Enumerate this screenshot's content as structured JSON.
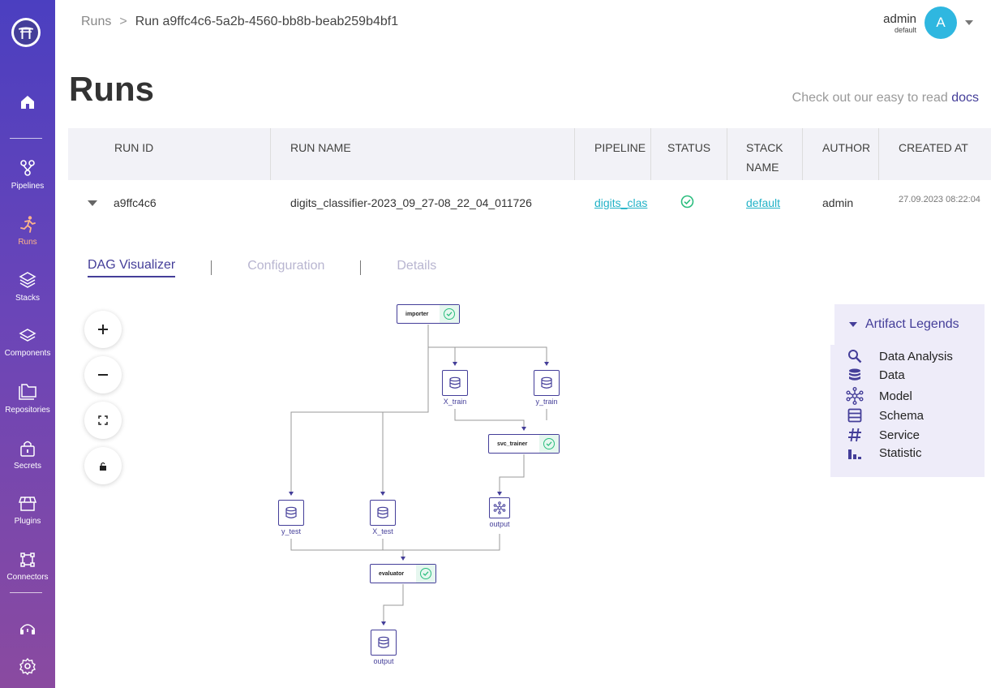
{
  "sidebar": {
    "items": [
      {
        "label": ""
      },
      {
        "label": "Pipelines"
      },
      {
        "label": "Runs"
      },
      {
        "label": "Stacks"
      },
      {
        "label": "Components"
      },
      {
        "label": "Repositories"
      },
      {
        "label": "Secrets"
      },
      {
        "label": "Plugins"
      },
      {
        "label": "Connectors"
      }
    ]
  },
  "breadcrumb": {
    "root": "Runs",
    "separator": ">",
    "current": "Run a9ffc4c6-5a2b-4560-bb8b-beab259b4bf1"
  },
  "user": {
    "name": "admin",
    "workspace": "default",
    "avatar_letter": "A"
  },
  "page": {
    "title": "Runs",
    "docs_prefix": "Check out our easy to read",
    "docs_link": "docs"
  },
  "table": {
    "headers": [
      "RUN ID",
      "RUN NAME",
      "PIPELINE",
      "STATUS",
      "STACK NAME",
      "AUTHOR",
      "CREATED AT"
    ],
    "row": {
      "run_id": "a9ffc4c6",
      "run_name": "digits_classifier-2023_09_27-08_22_04_011726",
      "pipeline": "digits_clas",
      "status": "completed",
      "stack": "default",
      "author": "admin",
      "created_at": "27.09.2023 08:22:04"
    }
  },
  "tabs": [
    "DAG Visualizer",
    "Configuration",
    "Details"
  ],
  "dag": {
    "steps": {
      "importer": "importer",
      "svc_trainer": "svc_trainer",
      "evaluator": "evaluator"
    },
    "artifacts": {
      "x_train": "X_train",
      "y_train": "y_train",
      "y_test": "y_test",
      "x_test": "X_test",
      "model_output": "output",
      "eval_output": "output"
    }
  },
  "legend": {
    "title": "Artifact Legends",
    "items": [
      "Data Analysis",
      "Data",
      "Model",
      "Schema",
      "Service",
      "Statistic"
    ]
  },
  "colors": {
    "accent": "#443e99",
    "success": "#2bbd7e",
    "link": "#22b2c7",
    "avatar": "#2fb7e0"
  }
}
